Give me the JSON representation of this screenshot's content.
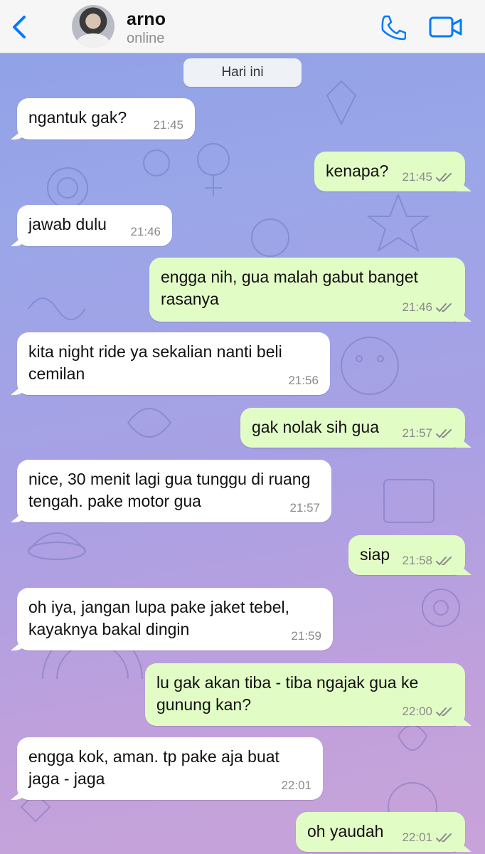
{
  "header": {
    "contact_name": "arno",
    "contact_status": "online"
  },
  "date_separator": "Hari ini",
  "colors": {
    "accent": "#007aff",
    "outgoing_bubble": "#e2fcc6",
    "incoming_bubble": "#ffffff"
  },
  "messages": [
    {
      "direction": "incoming",
      "text": "ngantuk gak?",
      "time": "21:45"
    },
    {
      "direction": "outgoing",
      "text": "kenapa?",
      "time": "21:45",
      "status": "read"
    },
    {
      "direction": "incoming",
      "text": "jawab dulu",
      "time": "21:46"
    },
    {
      "direction": "outgoing",
      "text": "engga nih, gua malah gabut banget rasanya",
      "time": "21:46",
      "status": "read"
    },
    {
      "direction": "incoming",
      "text": "kita night ride ya sekalian nanti beli cemilan",
      "time": "21:56"
    },
    {
      "direction": "outgoing",
      "text": "gak nolak sih gua",
      "time": "21:57",
      "status": "read"
    },
    {
      "direction": "incoming",
      "text": "nice, 30 menit lagi gua tunggu di ruang tengah. pake motor gua",
      "time": "21:57"
    },
    {
      "direction": "outgoing",
      "text": "siap",
      "time": "21:58",
      "status": "read"
    },
    {
      "direction": "incoming",
      "text": "oh iya, jangan lupa pake jaket tebel, kayaknya bakal dingin",
      "time": "21:59"
    },
    {
      "direction": "outgoing",
      "text": "lu gak akan tiba - tiba ngajak gua ke gunung kan?",
      "time": "22:00",
      "status": "read"
    },
    {
      "direction": "incoming",
      "text": "engga kok, aman. tp pake aja buat jaga - jaga",
      "time": "22:01"
    },
    {
      "direction": "outgoing",
      "text": "oh yaudah",
      "time": "22:01",
      "status": "read"
    }
  ]
}
